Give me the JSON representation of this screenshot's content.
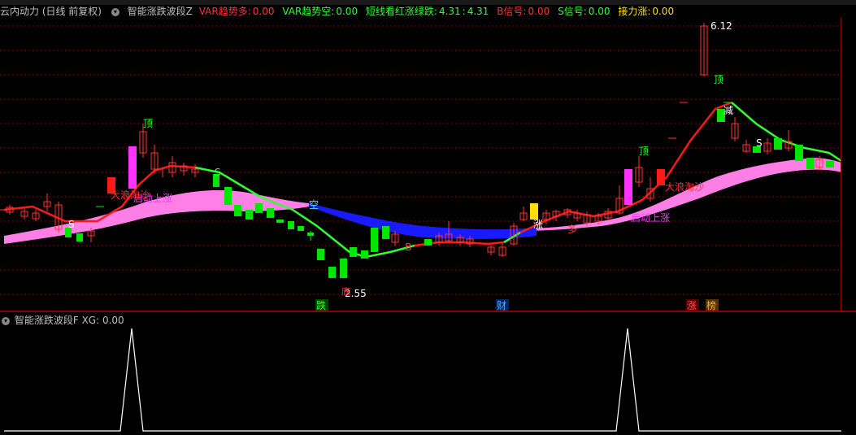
{
  "header": {
    "stock_name": "云内动力 (日线 前复权)",
    "indicator_name": "智能涨跌波段Z",
    "var_up_label": "VAR趋势多:",
    "var_up_value": "0.00",
    "var_down_label": "VAR趋势空:",
    "var_down_value": "0.00",
    "short_label": "短线看红涨绿跌:",
    "short_value1": "4.31",
    "short_value2": "4.31",
    "b_label": "B信号:",
    "b_value": "0.00",
    "s_label": "S信号:",
    "s_value": "0.00",
    "relay_label": "接力涨:",
    "relay_value": "0.00"
  },
  "colors": {
    "up": "#ff3333",
    "down": "#00e600",
    "band_pink": "#ff7fe6",
    "band_blue": "#1a1aff",
    "trend_green": "#33ff33",
    "trend_red": "#ff1a1a",
    "magenta": "#ff33ff",
    "yellow": "#ffe000",
    "cyan": "#55e0ff",
    "grid": "#8b0000"
  },
  "annotations": {
    "high_price": "6.12",
    "low_price": "2.55",
    "top1": "顶",
    "top2": "顶",
    "top3": "顶",
    "reduce": "减",
    "empty": "空",
    "rise_tag": "涨",
    "multi": "多",
    "start_up1": "启动上涨",
    "start_up2": "启动上涨",
    "big_wave1": "大浪淘沙",
    "big_wave2": "大浪淘沙",
    "s1": "S",
    "s2": "S",
    "s3": "S",
    "b1": "B",
    "bottom_mark": "底"
  },
  "bottom_tags": {
    "fall": "跌",
    "wealth": "财",
    "rise": "涨",
    "list": "榜"
  },
  "sub_header": {
    "name": "智能涨跌波段F",
    "xg_label": "XG:",
    "xg_value": "0.00"
  }
}
